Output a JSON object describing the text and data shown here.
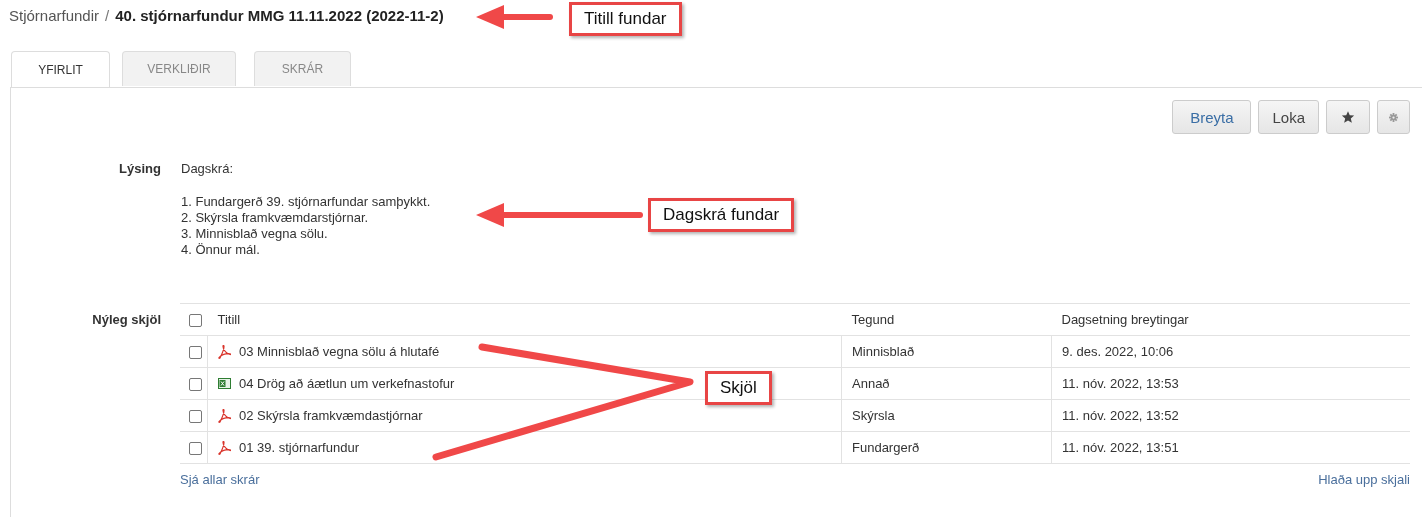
{
  "breadcrumb": {
    "parent": "Stjórnarfundir",
    "separator": "/",
    "title": "40. stjórnarfundur MMG 11.11.2022 (2022-11-2)"
  },
  "tabs": [
    {
      "label": "YFIRLIT",
      "selected": true
    },
    {
      "label": "VERKLIÐIR",
      "selected": false
    },
    {
      "label": "SKRÁR",
      "selected": false
    }
  ],
  "toolbar": [
    {
      "kind": "text",
      "label": "Breyta",
      "primary": true
    },
    {
      "kind": "text",
      "label": "Loka",
      "primary": false
    },
    {
      "kind": "star"
    },
    {
      "kind": "gear"
    }
  ],
  "description": {
    "label": "Lýsing",
    "heading": "Dagskrá:",
    "items": [
      "1. Fundargerð 39. stjórnarfundar samþykkt.",
      "2. Skýrsla framkvæmdarstjórnar.",
      "3. Minnisblað vegna sölu.",
      "4. Önnur mál."
    ]
  },
  "documents": {
    "label": "Nýleg skjöl",
    "select_all_checked": false,
    "columns": [
      "Titill",
      "Tegund",
      "Dagsetning breytingar"
    ],
    "rows": [
      {
        "checked": false,
        "kind": "pdf",
        "title": "03 Minnisblað vegna sölu á hlutafé",
        "type": "Minnisblað",
        "date": "9. des. 2022, 10:06"
      },
      {
        "checked": false,
        "kind": "excel",
        "title": "04 Drög að áætlun um verkefnastofur",
        "type": "Annað",
        "date": "11. nóv. 2022, 13:53"
      },
      {
        "checked": false,
        "kind": "pdf",
        "title": "02 Skýrsla framkvæmdastjórnar",
        "type": "Skýrsla",
        "date": "11. nóv. 2022, 13:52"
      },
      {
        "checked": false,
        "kind": "pdf",
        "title": "01 39. stjórnarfundur",
        "type": "Fundargerð",
        "date": "11. nóv. 2022, 13:51"
      }
    ],
    "see_all_link": "Sjá allar skrár",
    "upload_link": "Hlaða upp skjali"
  },
  "annotations": [
    {
      "text": "Titill fundar",
      "kind": "arrow"
    },
    {
      "text": "Dagskrá fundar",
      "kind": "arrow"
    },
    {
      "text": "Skjöl",
      "kind": "lines"
    }
  ]
}
